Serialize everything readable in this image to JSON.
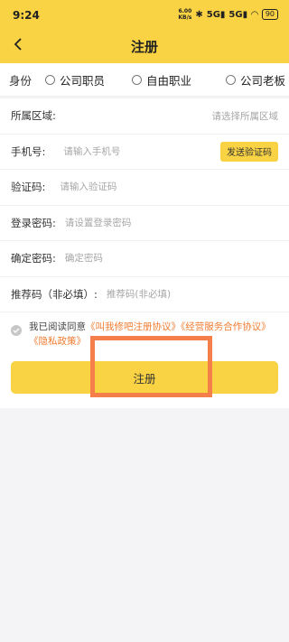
{
  "status_bar": {
    "time": "9:24",
    "net_speed_value": "6.00",
    "net_speed_unit": "KB/s",
    "network_labels": [
      "5G",
      "5G"
    ],
    "battery": "90"
  },
  "nav": {
    "title": "注册"
  },
  "identity": {
    "label": "身份",
    "options": [
      "公司职员",
      "自由职业",
      "公司老板"
    ]
  },
  "form": {
    "region": {
      "label": "所属区域:",
      "value": "请选择所属区域"
    },
    "phone": {
      "label": "手机号:",
      "placeholder": "请输入手机号",
      "send_code_label": "发送验证码"
    },
    "code": {
      "label": "验证码:",
      "placeholder": "请输入验证码"
    },
    "password": {
      "label": "登录密码:",
      "placeholder": "请设置登录密码"
    },
    "confirm": {
      "label": "确定密码:",
      "placeholder": "确定密码"
    },
    "referral": {
      "label": "推荐码（非必填）:",
      "placeholder": "推荐码(非必填)"
    }
  },
  "agreement": {
    "prefix": "我已阅读同意",
    "link_register": "《叫我修吧注册协议》",
    "link_cooperation": "《经营服务合作协议》",
    "link_privacy": "《隐私政策》"
  },
  "register_button_label": "注册",
  "colors": {
    "brand": "#f9d343",
    "link": "#f07c31",
    "highlight": "#f47f4a"
  }
}
